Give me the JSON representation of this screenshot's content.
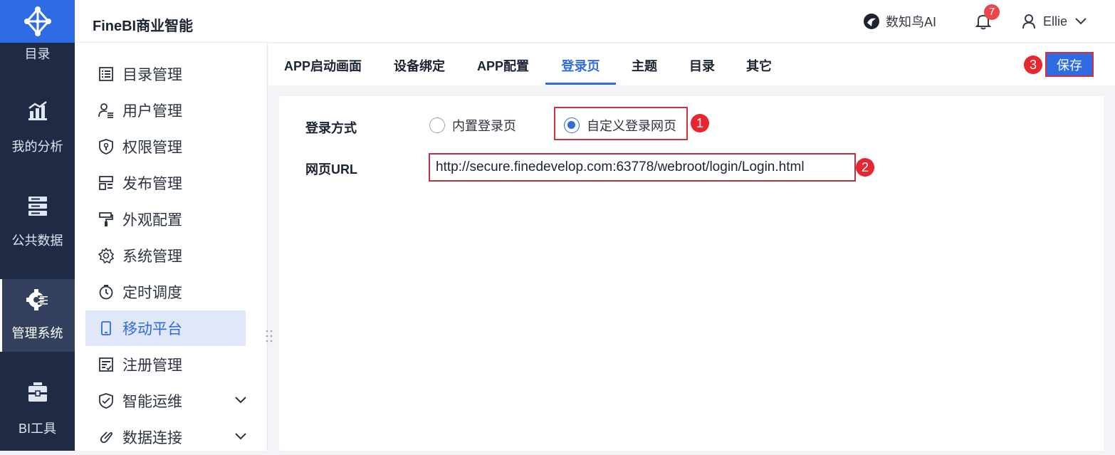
{
  "rail": {
    "items": [
      {
        "label": "目录",
        "icon": "catalog-icon"
      },
      {
        "label": "我的分析",
        "icon": "analysis-chart-icon"
      },
      {
        "label": "公共数据",
        "icon": "database-icon"
      },
      {
        "label": "管理系统",
        "icon": "management-gear-icon"
      },
      {
        "label": "BI工具",
        "icon": "toolbox-icon"
      }
    ]
  },
  "header": {
    "title": "FineBI商业智能",
    "ai_label": "数知鸟AI",
    "notification_count": "7",
    "user_name": "Ellie"
  },
  "menu": {
    "items": [
      {
        "label": "目录管理",
        "icon": "list-icon"
      },
      {
        "label": "用户管理",
        "icon": "user-list-icon"
      },
      {
        "label": "权限管理",
        "icon": "shield-icon"
      },
      {
        "label": "发布管理",
        "icon": "publish-icon"
      },
      {
        "label": "外观配置",
        "icon": "paint-roller-icon"
      },
      {
        "label": "系统管理",
        "icon": "gear-icon"
      },
      {
        "label": "定时调度",
        "icon": "stopwatch-icon"
      },
      {
        "label": "移动平台",
        "icon": "mobile-icon"
      },
      {
        "label": "注册管理",
        "icon": "register-icon"
      },
      {
        "label": "智能运维",
        "icon": "smart-ops-icon"
      },
      {
        "label": "数据连接",
        "icon": "link-icon"
      }
    ]
  },
  "tabs": {
    "items": [
      "APP启动画面",
      "设备绑定",
      "APP配置",
      "登录页",
      "主题",
      "目录",
      "其它"
    ],
    "active": "登录页",
    "save_label": "保存"
  },
  "form": {
    "login_method_label": "登录方式",
    "option_builtin": "内置登录页",
    "option_custom": "自定义登录网页",
    "url_label": "网页URL",
    "url_value": "http://secure.finedevelop.com:63778/webroot/login/Login.html"
  },
  "markers": {
    "m1": "1",
    "m2": "2",
    "m3": "3"
  },
  "colors": {
    "accent": "#2f6ce4",
    "rail_bg": "#1f2b44",
    "highlight_red": "#d8303b"
  }
}
